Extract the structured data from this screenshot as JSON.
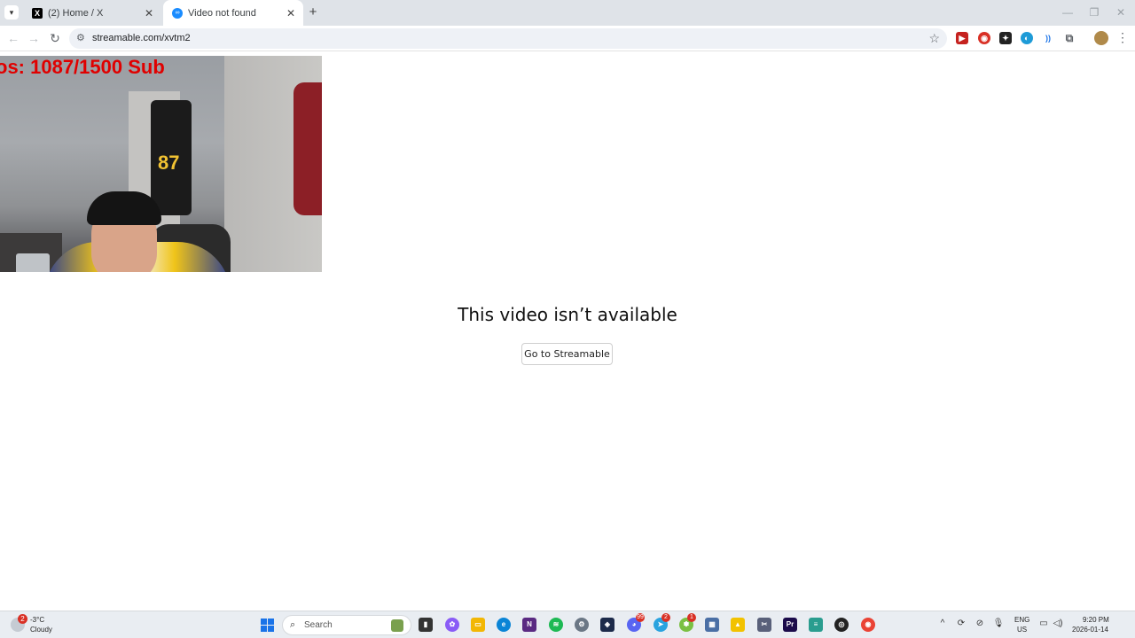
{
  "browser": {
    "tabs": [
      {
        "title": "(2) Home / X",
        "favicon": "x-logo-icon"
      },
      {
        "title": "Video not found",
        "favicon": "streamable-icon",
        "active": true
      }
    ],
    "url": "streamable.com/xvtm2",
    "new_tab_label": "+",
    "close_glyph": "✕",
    "star_glyph": "☆",
    "menu_glyph": "⋮"
  },
  "webcam_overlay": {
    "text": "os: 1087/1500  Sub"
  },
  "jersey_number": "87",
  "page": {
    "headline": "This video isn’t available",
    "button_label": "Go to Streamable"
  },
  "taskbar": {
    "weather": {
      "badge": "2",
      "temp": "-3°C",
      "desc": "Cloudy"
    },
    "search_placeholder": "Search",
    "language": {
      "line1": "ENG",
      "line2": "US"
    },
    "clock": {
      "time": "9:20 PM",
      "date": "2026-01-14"
    },
    "badges": {
      "discord": "99",
      "telegram": "2",
      "app_badge": "1"
    }
  },
  "colors": {
    "overlay_red": "#e00000",
    "tabstrip_bg": "#dfe3e8",
    "omnibox_bg": "#eef1f6",
    "taskbar_bg": "#e9edf2"
  }
}
